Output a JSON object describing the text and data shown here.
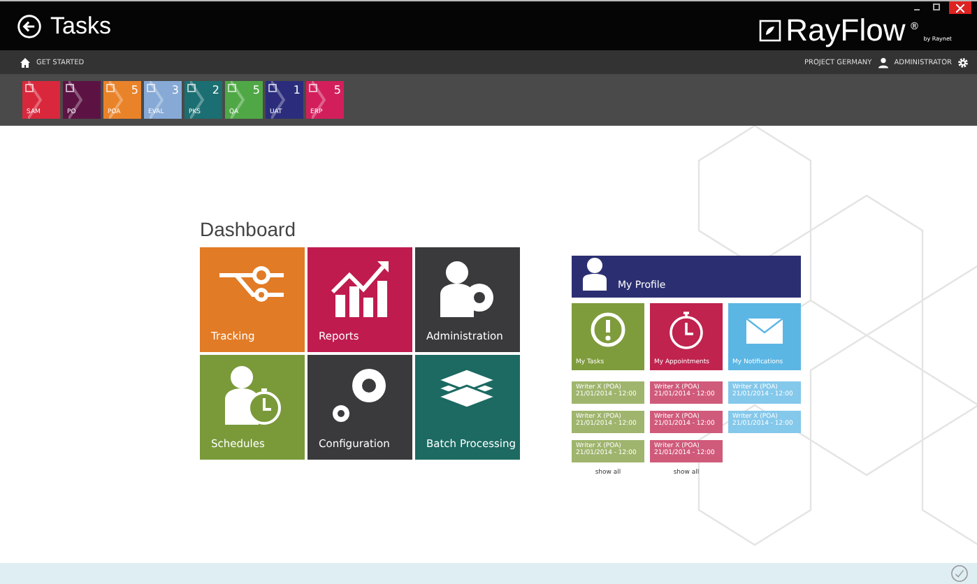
{
  "window": {
    "title": "Tasks",
    "brand": "RayFlow",
    "brand_mark": "®",
    "brand_sub": "by Raynet"
  },
  "nav": {
    "home": "GET STARTED",
    "project": "PROJECT GERMANY",
    "user": "ADMINISTRATOR"
  },
  "task_tiles": [
    {
      "label": "SAM",
      "color": "#d9283c"
    },
    {
      "label": "PO",
      "color": "#5c1344"
    },
    {
      "label": "POA",
      "count": "5",
      "color": "#e9832a"
    },
    {
      "label": "EVAL",
      "count": "3",
      "color": "#86a9d6"
    },
    {
      "label": "PKS",
      "count": "2",
      "color": "#1b6f72"
    },
    {
      "label": "QA",
      "count": "5",
      "color": "#4fa845"
    },
    {
      "label": "UAT",
      "count": "1",
      "color": "#2b2d7c"
    },
    {
      "label": "ERP",
      "count": "5",
      "color": "#d21f5c"
    }
  ],
  "dashboard": {
    "title": "Dashboard",
    "tiles": [
      {
        "label": "Tracking",
        "color": "#e27b25"
      },
      {
        "label": "Reports",
        "color": "#bf1b4e"
      },
      {
        "label": "Administration",
        "color": "#3a3a3c"
      },
      {
        "label": "Schedules",
        "color": "#7a9a3a"
      },
      {
        "label": "Configuration",
        "color": "#3a3a3c"
      },
      {
        "label": "Batch Processing",
        "color": "#1c6a62"
      }
    ]
  },
  "profile": {
    "title": "My Profile",
    "columns": [
      {
        "title": "My Tasks",
        "color": "#7f9c3c",
        "items": [
          {
            "title": "Writer X (POA)",
            "time": "21/01/2014 - 12:00"
          },
          {
            "title": "Writer X (POA)",
            "time": "21/01/2014 - 12:00"
          },
          {
            "title": "Writer X (POA)",
            "time": "21/01/2014 - 12:00"
          }
        ],
        "show_all": "show all"
      },
      {
        "title": "My Appointments",
        "color": "#c0234e",
        "items": [
          {
            "title": "Writer X (POA)",
            "time": "21/01/2014 - 12:00"
          },
          {
            "title": "Writer X (POA)",
            "time": "21/01/2014 - 12:00"
          },
          {
            "title": "Writer X (POA)",
            "time": "21/01/2014 - 12:00"
          }
        ],
        "show_all": "show all"
      },
      {
        "title": "My Notifications",
        "color": "#5bb6e4",
        "items": [
          {
            "title": "Writer X (POA)",
            "time": "21/01/2014 - 12:00"
          },
          {
            "title": "Writer X (POA)",
            "time": "21/01/2014 - 12:00"
          }
        ]
      }
    ]
  }
}
